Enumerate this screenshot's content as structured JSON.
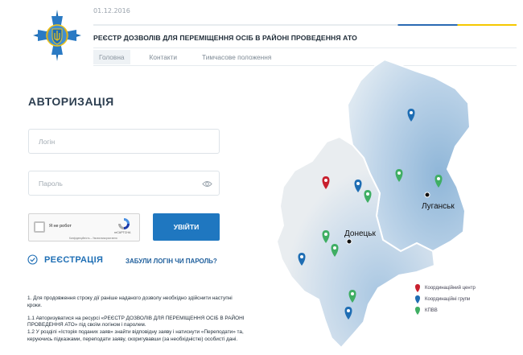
{
  "header": {
    "date": "01.12.2016",
    "title": "РЕЄСТР ДОЗВОЛІВ ДЛЯ ПЕРЕМІЩЕННЯ ОСІБ В РАЙОНІ ПРОВЕДЕННЯ АТО",
    "nav": [
      "Головна",
      "Контакти",
      "Тимчасове положення"
    ],
    "flag_colors": [
      "#2a6ab3",
      "#f5c800"
    ]
  },
  "auth": {
    "title": "АВТОРИЗАЦІЯ",
    "login_placeholder": "Логін",
    "password_placeholder": "Пароль",
    "captcha_label": "Я не робот",
    "captcha_brand": "reCAPTCHA",
    "captcha_terms": "Конфіденційність – Умови використання",
    "submit_label": "УВІЙТИ",
    "register_label": "РЕЄСТРАЦІЯ",
    "forgot_label": "ЗАБУЛИ ЛОГІН ЧИ ПАРОЛЬ?",
    "accent_color": "#1f77c0"
  },
  "instructions": {
    "p1": "1. Для продовження строку дії раніше наданого дозволу необхідно здійснити наступні кроки.",
    "p2": "1.1 Авторизуватися на ресурсі «РЕЄСТР ДОЗВОЛІВ ДЛЯ ПЕРЕМІЩЕННЯ ОСІБ В РАЙОНІ ПРОВЕДЕННЯ АТО» під своїм логіном і паролем.",
    "p3": "1.2 У розділі «Історія поданих заяв» знайти відповідну заяву і натиснути «Переподати» та, керуючись підказками, переподати заяву, скоригувавши (за необхідністю) особисті дані."
  },
  "map": {
    "cities": [
      "Донецьк",
      "Луганськ"
    ],
    "legend": [
      {
        "label": "Координаційний центр",
        "color": "#c8202e",
        "icon": "red-marker-icon"
      },
      {
        "label": "Координаційні групи",
        "color": "#1e6db3",
        "icon": "blue-marker-icon"
      },
      {
        "label": "КПВВ",
        "color": "#3fae63",
        "icon": "green-marker-icon"
      }
    ]
  }
}
